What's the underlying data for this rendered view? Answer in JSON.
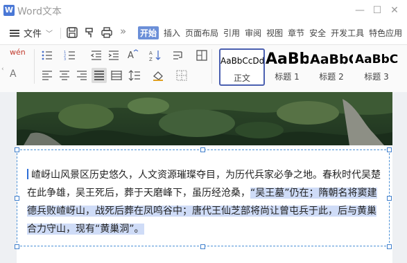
{
  "window": {
    "title": "Word文本",
    "logo_letter": "W"
  },
  "menubar": {
    "file_label": "文件",
    "more_glyph": "»",
    "tabs": [
      "开始",
      "插入",
      "页面布局",
      "引用",
      "审阅",
      "视图",
      "章节",
      "安全",
      "开发工具",
      "特色应用"
    ],
    "active_tab_index": 0
  },
  "ribbon": {
    "styles": [
      {
        "sample": "AaBbCcDd",
        "label": "正文",
        "selected": true
      },
      {
        "sample": "AaBb",
        "label": "标题 1",
        "selected": false
      },
      {
        "sample": "AaBbC",
        "label": "标题 2",
        "selected": false
      },
      {
        "sample": "AaBbC",
        "label": "标题 3",
        "selected": false
      }
    ],
    "pinyin_glyph": "wén",
    "font_glyph": "A"
  },
  "document": {
    "paragraph_plain": "嵖岈山风景区历史悠久，人文资源璀璨夺目，为历代兵家必争之地。春秋时代吴楚在此争雄，吴王死后，葬于天磨峰下，虽历经沧桑，",
    "paragraph_selected": "“吴王墓”仍在；隋朝名将窦建德兵败嵖岈山，战死后葬在凤鸣谷中；唐代王仙芝部将尚让曾屯兵于此，后与黄巢合力守山，现有“黄巢洞”。"
  },
  "colors": {
    "accent": "#6b8fd8",
    "selection": "#cfdcf7",
    "frame": "#4a90d6"
  }
}
